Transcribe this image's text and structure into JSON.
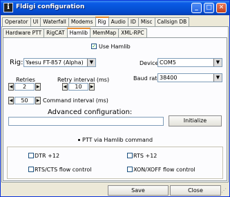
{
  "window": {
    "title": "Fldigi configuration",
    "icon": "fldigi-app-icon"
  },
  "titlebar_buttons": [
    {
      "name": "minimize-button",
      "glyph": "_"
    },
    {
      "name": "maximize-button",
      "glyph": "□"
    },
    {
      "name": "close-button",
      "glyph": "✕"
    }
  ],
  "main_tabs": [
    {
      "label": "Operator",
      "active": false
    },
    {
      "label": "UI",
      "active": false
    },
    {
      "label": "Waterfall",
      "active": false
    },
    {
      "label": "Modems",
      "active": false
    },
    {
      "label": "Rig",
      "active": true
    },
    {
      "label": "Audio",
      "active": false
    },
    {
      "label": "ID",
      "active": false
    },
    {
      "label": "Misc",
      "active": false
    },
    {
      "label": "Callsign DB",
      "active": false
    }
  ],
  "sub_tabs": [
    {
      "label": "Hardware PTT",
      "active": false
    },
    {
      "label": "RigCAT",
      "active": false
    },
    {
      "label": "Hamlib",
      "active": true
    },
    {
      "label": "MemMap",
      "active": false
    },
    {
      "label": "XML-RPC",
      "active": false
    }
  ],
  "hamlib": {
    "use_hamlib_label": "Use Hamlib",
    "use_hamlib_checked": true,
    "rig_label": "Rig:",
    "rig_value": "Yaesu FT-857  (Alpha)",
    "device_label": "Device:",
    "device_value": "COM5",
    "baud_label": "Baud rate:",
    "baud_value": "38400",
    "retries_label": "Retries",
    "retries_value": "2",
    "retry_interval_label": "Retry interval (ms)",
    "retry_interval_value": "10",
    "command_interval_value": "50",
    "command_interval_label": "Command interval (ms)",
    "advanced_label": "Advanced configuration:",
    "advanced_value": "",
    "initialize_label": "Initialize",
    "ptt_via_hamlib_label": "PTT via Hamlib command",
    "ptt_via_hamlib_checked": true
  },
  "options": {
    "dtr_label": "DTR +12",
    "rts_label": "RTS +12",
    "rts_cts_label": "RTS/CTS flow control",
    "xon_xoff_label": "XON/XOFF flow control"
  },
  "footer": {
    "save_label": "Save",
    "close_label": "Close"
  },
  "colors": {
    "titlebar": "#0653d8",
    "tab_highlight": "#e68b2c",
    "check_mark": "#21a121"
  }
}
